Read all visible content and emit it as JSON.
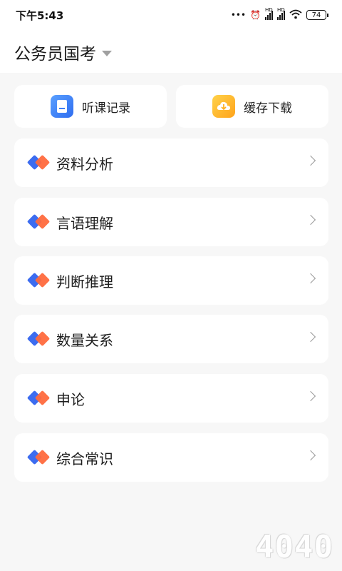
{
  "status_bar": {
    "time": "下午5:43",
    "battery": "74",
    "icons": [
      "more-dots-icon",
      "alarm-icon",
      "hd-signal-icon",
      "hd-signal-icon",
      "wifi-icon",
      "battery-icon"
    ]
  },
  "header": {
    "title": "公务员国考"
  },
  "quick_actions": [
    {
      "label": "听课记录",
      "icon": "record-book-icon",
      "color": "#3f7ff5"
    },
    {
      "label": "缓存下载",
      "icon": "download-cloud-icon",
      "color": "#ffb020"
    }
  ],
  "categories": [
    {
      "label": "资料分析"
    },
    {
      "label": "言语理解"
    },
    {
      "label": "判断推理"
    },
    {
      "label": "数量关系"
    },
    {
      "label": "申论"
    },
    {
      "label": "综合常识"
    }
  ],
  "watermark": "4040",
  "colors": {
    "accent_blue": "#3c6cf0",
    "accent_orange": "#ff6a3d",
    "background": "#f7f7f7"
  }
}
